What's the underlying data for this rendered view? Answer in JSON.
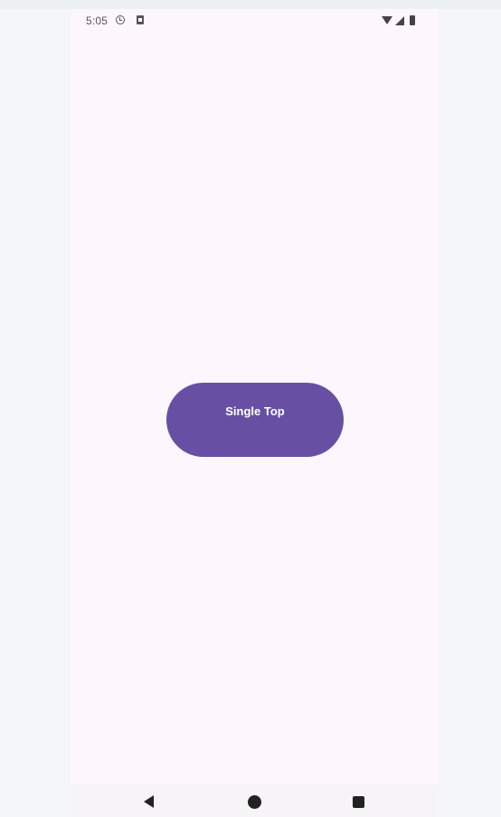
{
  "status_bar": {
    "time": "5:05",
    "left_icons": [
      "alarm-icon",
      "sim-icon"
    ],
    "right_icons": [
      "wifi-icon",
      "signal-icon",
      "battery-icon"
    ]
  },
  "main": {
    "button_label": "Single Top",
    "button_color": "#6750a4",
    "background_color": "#fdf7fd"
  },
  "nav_bar": {
    "buttons": [
      "back-icon",
      "home-icon",
      "recents-icon"
    ]
  }
}
